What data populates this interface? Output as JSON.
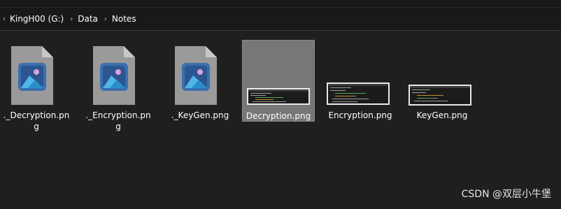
{
  "breadcrumb": {
    "items": [
      "KingH00 (G:)",
      "Data",
      "Notes"
    ]
  },
  "files": [
    {
      "name": "._Decryption.png",
      "line1": "._Decryption.pn",
      "line2": "g",
      "type": "generic-image"
    },
    {
      "name": "._Encryption.png",
      "line1": "._Encryption.pn",
      "line2": "g",
      "type": "generic-image"
    },
    {
      "name": "._KeyGen.png",
      "line1": "._KeyGen.png",
      "line2": "",
      "type": "generic-image"
    },
    {
      "name": "Decryption.png",
      "line1": "Decryption.png",
      "line2": "",
      "type": "thumbnail",
      "selected": true
    },
    {
      "name": "Encryption.png",
      "line1": "Encryption.png",
      "line2": "",
      "type": "thumbnail"
    },
    {
      "name": "KeyGen.png",
      "line1": "KeyGen.png",
      "line2": "",
      "type": "thumbnail"
    }
  ],
  "watermark": "CSDN @双层小牛堡",
  "colors": {
    "background": "#1f1f1f",
    "selection": "#777777",
    "doc_page": "#9a9a9a",
    "photo_icon_bg": "#3a6fb0"
  }
}
